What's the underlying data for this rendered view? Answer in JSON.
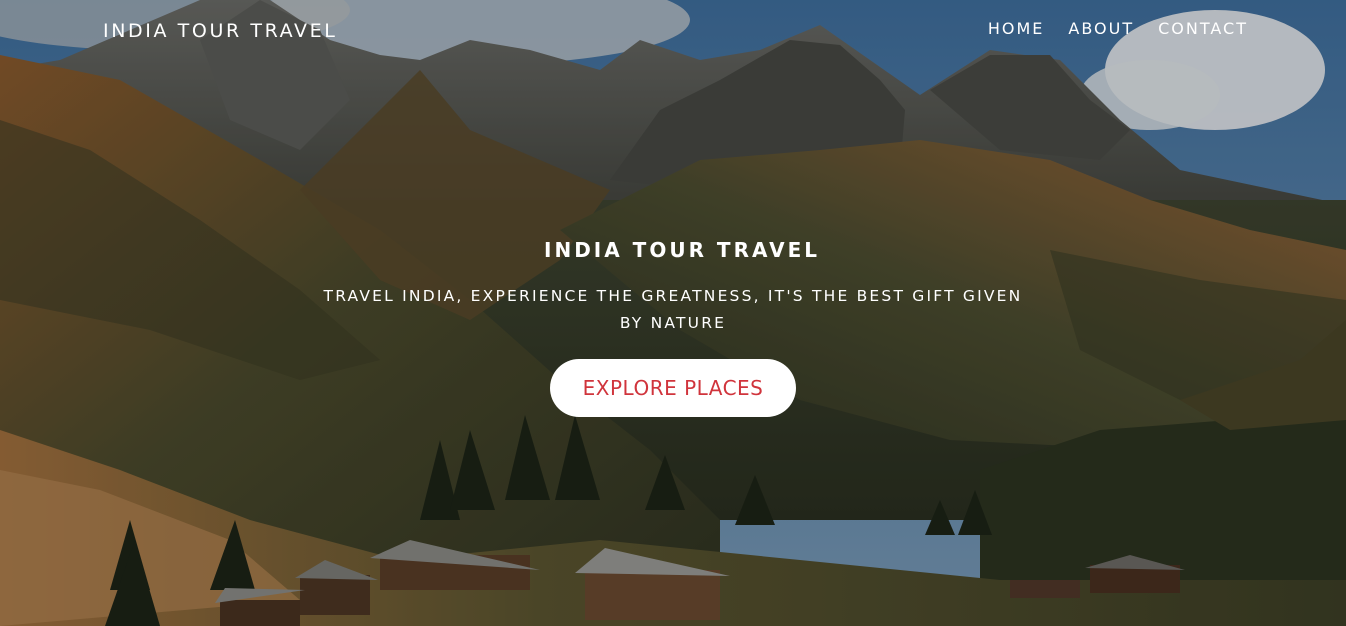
{
  "header": {
    "brand": "INDIA TOUR TRAVEL",
    "nav": [
      {
        "label": "HOME"
      },
      {
        "label": "ABOUT"
      },
      {
        "label": "CONTACT"
      }
    ]
  },
  "hero": {
    "title": "INDIA TOUR TRAVEL",
    "subtitle": "TRAVEL INDIA, EXPERIENCE THE GREATNESS, IT'S THE BEST GIFT GIVEN BY NATURE",
    "cta_label": "EXPLORE PLACES"
  },
  "colors": {
    "cta_text": "#d0343c",
    "cta_bg": "#ffffff",
    "text": "#ffffff",
    "sky": "#4a79a8"
  }
}
